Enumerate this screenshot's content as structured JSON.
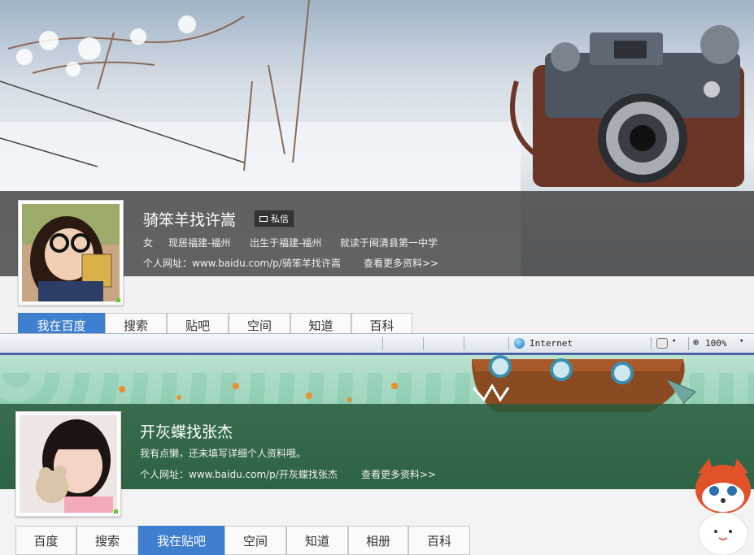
{
  "top_profile": {
    "username": "骑笨羊找许嵩",
    "message_button": "私信",
    "gender": "女",
    "residence": "现居福建-福州",
    "birthplace": "出生于福建-福州",
    "school": "就读于闽清县第一中学",
    "homepage_label": "个人网址：",
    "homepage_url": "www.baidu.com/p/骑笨羊找许嵩",
    "more_info": "查看更多资料>>",
    "tabs": [
      "我在百度",
      "搜索",
      "贴吧",
      "空间",
      "知道",
      "百科"
    ],
    "active_tab": 0
  },
  "status_bar": {
    "zone": "Internet",
    "zoom": "100%"
  },
  "bottom_profile": {
    "username": "开灰蝶找张杰",
    "bio": "我有点懒，还未填写详细个人资料哦。",
    "homepage_label": "个人网址：",
    "homepage_url": "www.baidu.com/p/开灰蝶找张杰",
    "more_info": "查看更多资料>>",
    "tabs": [
      "百度",
      "搜索",
      "我在贴吧",
      "空间",
      "知道",
      "相册",
      "百科"
    ],
    "active_tab": 2
  },
  "colors": {
    "active_tab": "#3f7fd0",
    "top_overlay": "#3c3c3c",
    "bottom_overlay": "#285a3c"
  }
}
